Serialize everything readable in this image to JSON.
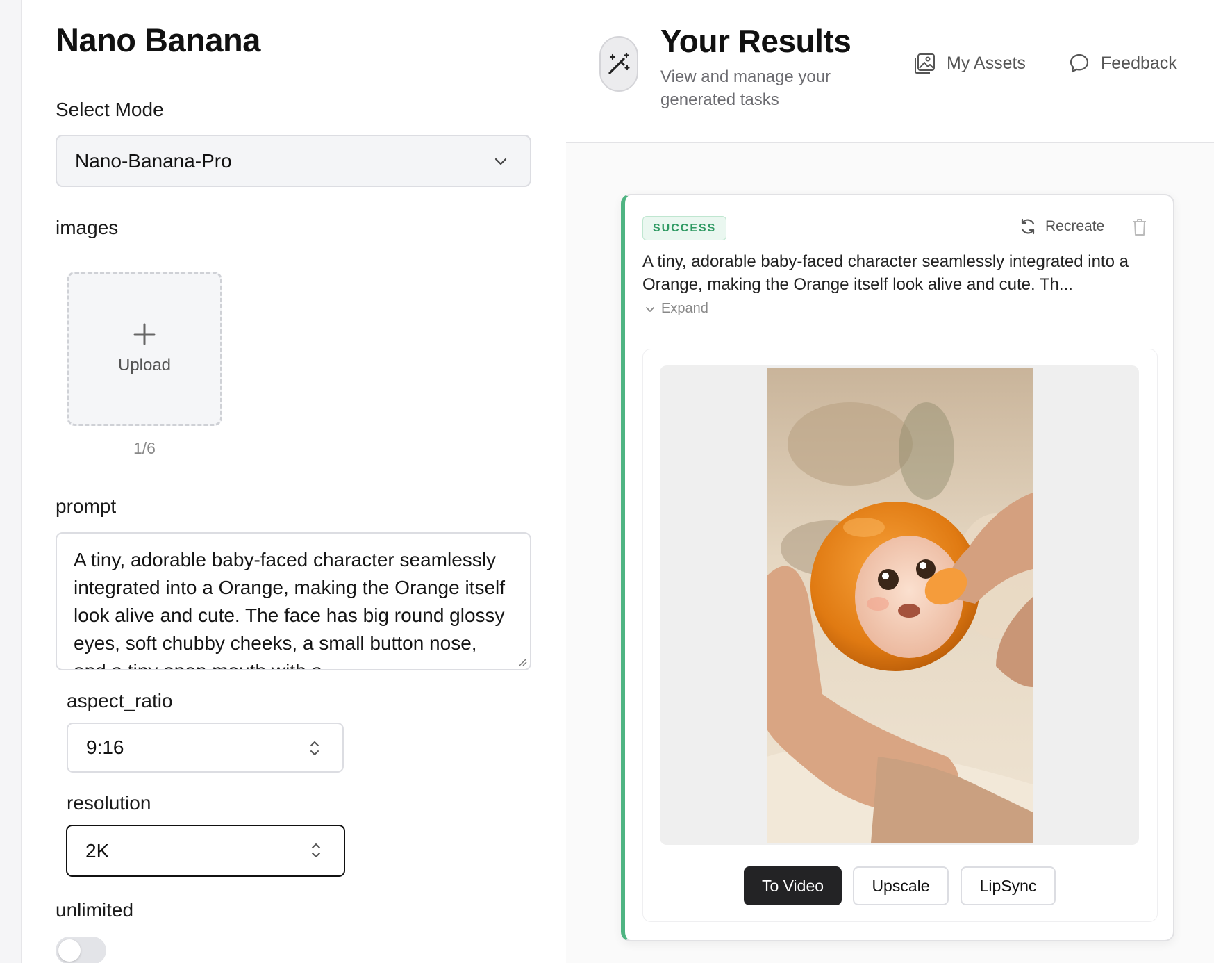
{
  "left": {
    "app_title": "Nano Banana",
    "mode_label": "Select Mode",
    "mode_value": "Nano-Banana-Pro",
    "images_label": "images",
    "upload_label": "Upload",
    "upload_count": "1/6",
    "prompt_label": "prompt",
    "prompt_text": "A tiny, adorable baby-faced character seamlessly integrated into a Orange, making the Orange itself look alive and cute. The face has big round glossy eyes, soft chubby cheeks, a small button nose, and a tiny open mouth with a",
    "aspect_ratio_label": "aspect_ratio",
    "aspect_ratio_value": "9:16",
    "resolution_label": "resolution",
    "resolution_value": "2K",
    "unlimited_label": "unlimited",
    "unlimited_on": false
  },
  "header": {
    "title": "Your Results",
    "subtitle": "View and manage your generated tasks",
    "my_assets": "My Assets",
    "feedback": "Feedback"
  },
  "card": {
    "status": "SUCCESS",
    "recreate": "Recreate",
    "description": "A tiny, adorable baby-faced character seamlessly integrated into a Orange, making the Orange itself look alive and cute. Th...",
    "expand": "Expand",
    "actions": [
      "To Video",
      "Upscale",
      "LipSync"
    ]
  },
  "colors": {
    "success_accent": "#4fb482",
    "primary_button": "#232325"
  },
  "icons": [
    "chevron-down-icon",
    "plus-icon",
    "updown-icon",
    "magic-wand-icon",
    "image-gallery-icon",
    "chat-bubble-icon",
    "refresh-icon",
    "trash-icon"
  ]
}
